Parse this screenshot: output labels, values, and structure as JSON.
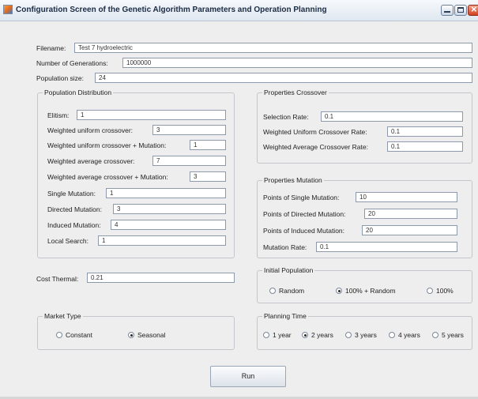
{
  "window": {
    "title": "Configuration Screen of the Genetic Algorithm Parameters and Operation Planning"
  },
  "main": {
    "filename": {
      "label": "Filename:",
      "value": "Test 7 hydroelectric"
    },
    "generations": {
      "label": "Number of Generations:",
      "value": "1000000"
    },
    "population_size": {
      "label": "Population size:",
      "value": "24"
    },
    "cost_thermal": {
      "label": "Cost Thermal:",
      "value": "0.21"
    }
  },
  "population_distribution": {
    "title": "Population Distribution",
    "items": [
      {
        "label": "Elitism:",
        "value": "1"
      },
      {
        "label": "Weighted uniform crossover:",
        "value": "3"
      },
      {
        "label": "Weighted uniform crossover + Mutation:",
        "value": "1"
      },
      {
        "label": "Weighted average crossover:",
        "value": "7"
      },
      {
        "label": "Weighted average crossover + Mutation:",
        "value": "3"
      },
      {
        "label": "Single Mutation:",
        "value": "1"
      },
      {
        "label": "Directed Mutation:",
        "value": "3"
      },
      {
        "label": "Induced Mutation:",
        "value": "4"
      },
      {
        "label": "Local Search:",
        "value": "1"
      }
    ]
  },
  "properties_crossover": {
    "title": "Properties Crossover",
    "items": [
      {
        "label": "Selection Rate:",
        "value": "0.1"
      },
      {
        "label": "Weighted Uniform Crossover Rate:",
        "value": "0.1"
      },
      {
        "label": "Weighted Average Crossover Rate:",
        "value": "0.1"
      }
    ]
  },
  "properties_mutation": {
    "title": "Properties Mutation",
    "items": [
      {
        "label": "Points of Single Mutation:",
        "value": "10"
      },
      {
        "label": "Points of Directed Mutation:",
        "value": "20"
      },
      {
        "label": "Points of Induced Mutation:",
        "value": "20"
      },
      {
        "label": "Mutation Rate:",
        "value": "0.1"
      }
    ]
  },
  "initial_population": {
    "title": "Initial Population",
    "options": [
      "Random",
      "100% + Random",
      "100%"
    ],
    "selected": "100% + Random"
  },
  "market_type": {
    "title": "Market Type",
    "options": [
      "Constant",
      "Seasonal"
    ],
    "selected": "Seasonal"
  },
  "planning_time": {
    "title": "Planning Time",
    "options": [
      "1 year",
      "2 years",
      "3 years",
      "4 years",
      "5 years"
    ],
    "selected": "2 years"
  },
  "actions": {
    "run_label": "Run"
  }
}
